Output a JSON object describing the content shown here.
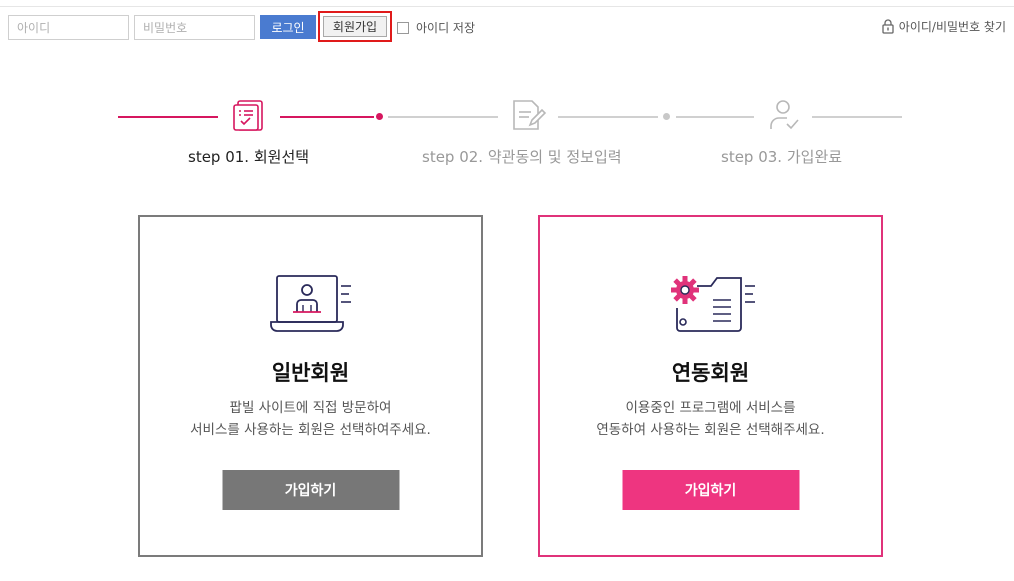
{
  "login": {
    "id_placeholder": "아이디",
    "pw_placeholder": "비밀번호",
    "login_label": "로그인",
    "join_label": "회원가입",
    "save_id_label": "아이디 저장",
    "find_label": "아이디/비밀번호 찾기"
  },
  "steps": [
    {
      "label": "step 01.  회원선택",
      "active": true
    },
    {
      "label": "step 02. 약관동의 및 정보입력",
      "active": false
    },
    {
      "label": "step 03.  가입완료",
      "active": false
    }
  ],
  "cards": [
    {
      "title": "일반회원",
      "desc_line1": "팝빌 사이트에 직접 방문하여",
      "desc_line2": "서비스를 사용하는 회원은 선택하여주세요.",
      "button": "가입하기"
    },
    {
      "title": "연동회원",
      "desc_line1": "이용중인 프로그램에 서비스를",
      "desc_line2": "연동하여 사용하는 회원은 선택해주세요.",
      "button": "가입하기"
    }
  ],
  "colors": {
    "accent": "#d6175f",
    "login_blue": "#4a7bd0",
    "card2_border": "#e0327a",
    "card1_button": "#777777",
    "card2_button": "#ee3580"
  },
  "icons": [
    "lock-icon",
    "checklist-icon",
    "edit-document-icon",
    "user-check-icon",
    "laptop-user-icon",
    "gear-folder-icon"
  ]
}
